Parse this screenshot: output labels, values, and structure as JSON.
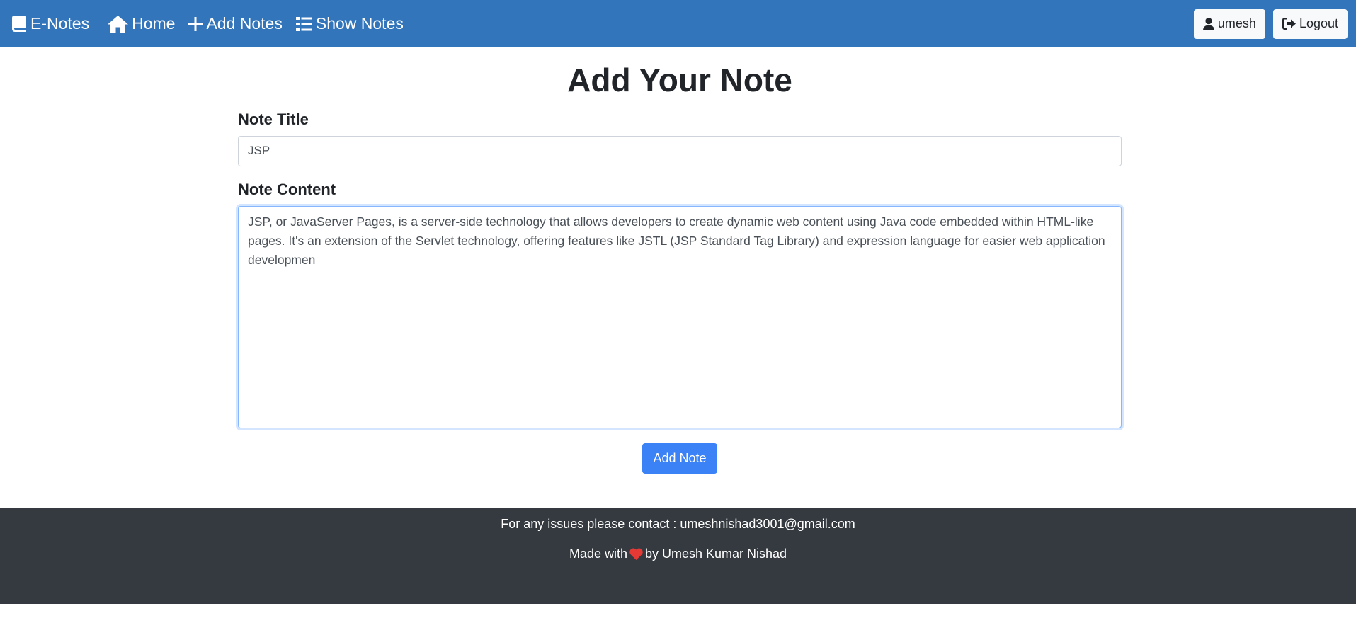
{
  "navbar": {
    "brand_label": "E-Notes",
    "home_label": "Home",
    "add_notes_label": "Add Notes",
    "show_notes_label": "Show Notes",
    "user_label": "umesh",
    "logout_label": "Logout"
  },
  "form": {
    "page_title": "Add Your Note",
    "title_label": "Note Title",
    "title_value": "JSP",
    "content_label": "Note Content",
    "content_value": "JSP, or JavaServer Pages, is a server-side technology that allows developers to create dynamic web content using Java code embedded within HTML-like pages. It's an extension of the Servlet technology, offering features like JSTL (JSP Standard Tag Library) and expression language for easier web application developmen",
    "submit_label": "Add Note"
  },
  "footer": {
    "contact_text": "For any issues please contact : umeshnishad3001@gmail.com",
    "made_with_prefix": "Made with",
    "made_with_suffix": "by Umesh Kumar Nishad"
  },
  "colors": {
    "navbar_bg": "#3375bb",
    "primary_button": "#3b82f6",
    "footer_bg": "#343a40",
    "heart": "#e53935"
  },
  "icons": {
    "brand": "book-icon",
    "home": "home-icon",
    "add": "plus-icon",
    "show": "list-icon",
    "user": "user-icon",
    "logout": "logout-icon",
    "footer": "heart-icon"
  }
}
